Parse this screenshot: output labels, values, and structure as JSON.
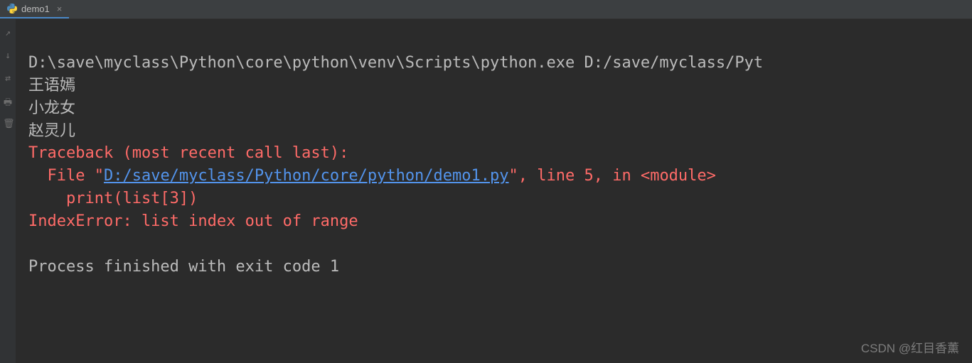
{
  "tab": {
    "label": "demo1",
    "close": "×"
  },
  "console": {
    "command": "D:\\save\\myclass\\Python\\core\\python\\venv\\Scripts\\python.exe D:/save/myclass/Pyt",
    "out1": "王语嫣",
    "out2": "小龙女",
    "out3": "赵灵儿",
    "traceback_header": "Traceback (most recent call last):",
    "file_prefix": "  File \"",
    "file_link": "D:/save/myclass/Python/core/python/demo1.py",
    "file_suffix": "\", line 5, in <module>",
    "code_line": "    print(list[3])",
    "error_message": "IndexError: list index out of range",
    "blank": "",
    "exit": "Process finished with exit code 1"
  },
  "watermark": "CSDN @红目香薰"
}
